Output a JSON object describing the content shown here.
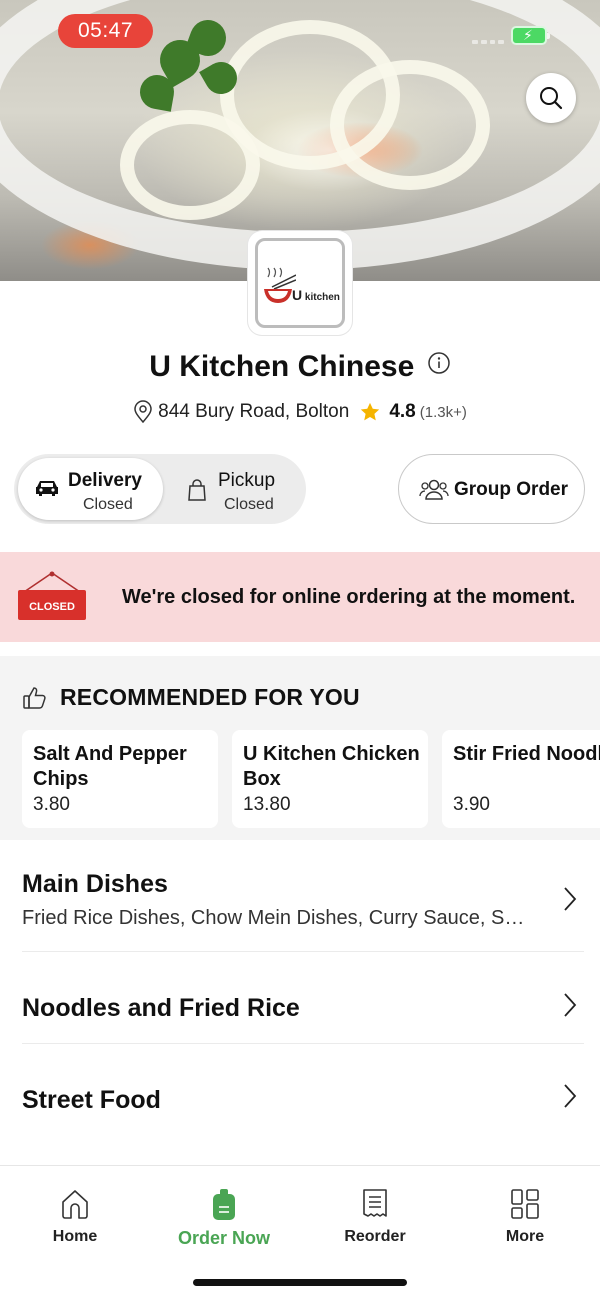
{
  "status_bar": {
    "time": "05:47"
  },
  "restaurant": {
    "name": "U Kitchen Chinese",
    "logo_text": "U",
    "logo_subtext": "kitchen",
    "address": "844 Bury Road, Bolton",
    "rating": "4.8",
    "rating_count": "(1.3k+)"
  },
  "order_mode": {
    "delivery": {
      "label": "Delivery",
      "status": "Closed",
      "selected": true
    },
    "pickup": {
      "label": "Pickup",
      "status": "Closed",
      "selected": false
    }
  },
  "group_order": {
    "label": "Group Order"
  },
  "closed_banner": {
    "sign_text": "CLOSED",
    "message": "We're closed for online ordering at the moment."
  },
  "recommended": {
    "title": "RECOMMENDED FOR YOU",
    "items": [
      {
        "name": "Salt And Pepper Chips",
        "price": "3.80"
      },
      {
        "name": "U Kitchen Chicken Box",
        "price": "13.80"
      },
      {
        "name": "Stir Fried Noodl",
        "price": "3.90"
      }
    ]
  },
  "categories": [
    {
      "title": "Main Dishes",
      "subtitle": "Fried Rice Dishes, Chow Mein Dishes, Curry Sauce, S…"
    },
    {
      "title": "Noodles and Fried Rice"
    },
    {
      "title": "Street Food"
    }
  ],
  "bottom_nav": {
    "items": [
      {
        "label": "Home",
        "icon": "home-icon",
        "active": false
      },
      {
        "label": "Order Now",
        "icon": "order-bag-icon",
        "active": true
      },
      {
        "label": "Reorder",
        "icon": "receipt-icon",
        "active": false
      },
      {
        "label": "More",
        "icon": "grid-icon",
        "active": false
      }
    ]
  },
  "colors": {
    "status_time_bg": "#e8443a",
    "closed_banner_bg": "#f9d9da",
    "closed_sign": "#d8302b",
    "active_nav": "#4aa554",
    "rating_star": "#f5b400"
  }
}
